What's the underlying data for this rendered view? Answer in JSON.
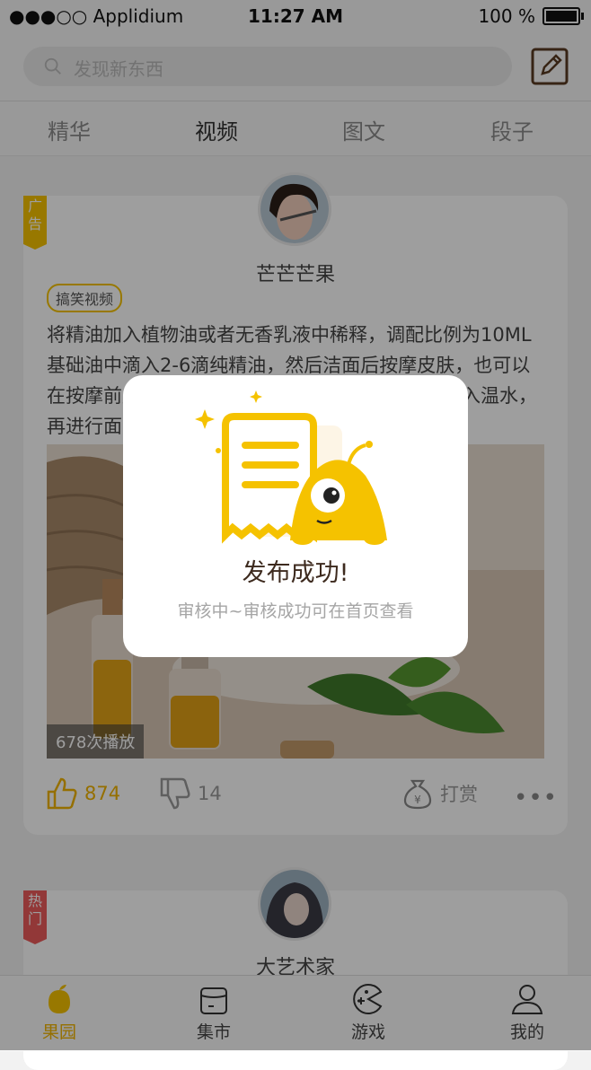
{
  "status_bar": {
    "carrier": "●●●○○ Applidium",
    "time": "11:27 AM",
    "battery": "100 %"
  },
  "search": {
    "placeholder": "发现新东西"
  },
  "tabs": [
    {
      "label": "精华"
    },
    {
      "label": "视频"
    },
    {
      "label": "图文"
    },
    {
      "label": "段子"
    }
  ],
  "active_tab": "视频",
  "posts": [
    {
      "ribbon": "广告",
      "author": "芒芒芒果",
      "tag": "搞笑视频",
      "text": "将精油加入植物油或者无香乳液中稀释，调配比例为10ML基础油中滴入2-6滴纯精油，然后洁面后按摩皮肤，也可以在按摩前后，配合使用手法，还可以在按摩前后滴入温水，再进行面部按摩护肤……",
      "play_count": "678次播放",
      "likes": "874",
      "dislikes": "14",
      "reward_label": "打赏"
    },
    {
      "ribbon": "热门",
      "author": "大艺术家"
    }
  ],
  "tabbar": [
    {
      "label": "果园",
      "icon": "mango-icon",
      "active": true
    },
    {
      "label": "集市",
      "icon": "shop-icon"
    },
    {
      "label": "游戏",
      "icon": "game-icon"
    },
    {
      "label": "我的",
      "icon": "profile-icon"
    }
  ],
  "modal": {
    "title": "发布成功!",
    "subtitle": "审核中~审核成功可在首页查看"
  },
  "colors": {
    "accent": "#f5c200",
    "hot": "#ec5b5b",
    "active_tab": "#f0b400"
  }
}
